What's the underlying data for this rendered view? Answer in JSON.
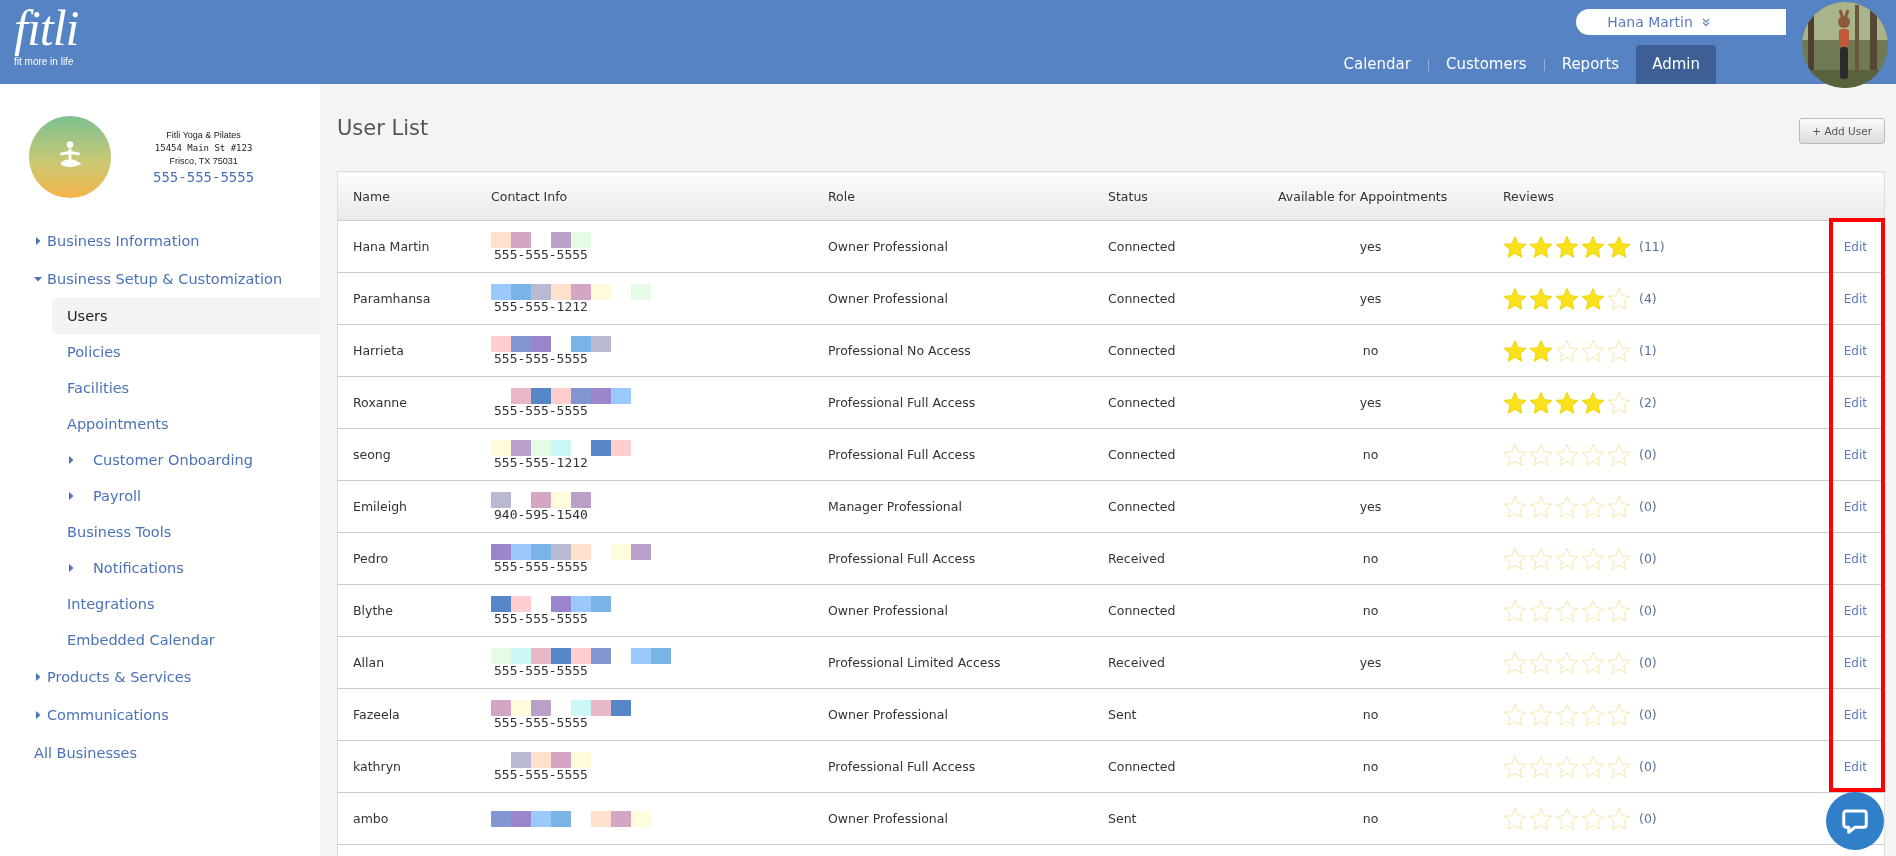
{
  "brand": {
    "name": "fitli",
    "tagline": "fit more in life"
  },
  "user_menu": {
    "name": "Hana Martin"
  },
  "nav_tabs": [
    {
      "label": "Calendar",
      "selected": false
    },
    {
      "label": "Customers",
      "selected": false
    },
    {
      "label": "Reports",
      "selected": false
    },
    {
      "label": "Admin",
      "selected": true
    }
  ],
  "business": {
    "name": "Fitli Yoga & Pilates",
    "address_line": "15454 Main St #123",
    "city_line": "Frisco, TX 75031",
    "phone": "555-555-5555"
  },
  "sidebar": {
    "items": [
      {
        "label": "Business Information",
        "expanded": false,
        "selected": false
      },
      {
        "label": "Business Setup & Customization",
        "expanded": true,
        "selected": false,
        "children": [
          {
            "label": "Users",
            "selected": true
          },
          {
            "label": "Policies",
            "selected": false
          },
          {
            "label": "Facilities",
            "selected": false
          },
          {
            "label": "Appointments",
            "selected": false
          },
          {
            "label": "Customer Onboarding",
            "expanded": false,
            "selected": false
          },
          {
            "label": "Payroll",
            "expanded": false,
            "selected": false
          },
          {
            "label": "Business Tools",
            "selected": false
          },
          {
            "label": "Notifications",
            "expanded": false,
            "selected": false
          },
          {
            "label": "Integrations",
            "selected": false
          },
          {
            "label": "Embedded Calendar",
            "selected": false
          }
        ]
      },
      {
        "label": "Products & Services",
        "expanded": false,
        "selected": false
      },
      {
        "label": "Communications",
        "expanded": false,
        "selected": false
      },
      {
        "label": "All Businesses",
        "selected": false
      }
    ]
  },
  "page_title": "User List",
  "add_button": "+ Add User",
  "table": {
    "columns": [
      "Name",
      "Contact Info",
      "Role",
      "Status",
      "Available for Appointments",
      "Reviews"
    ],
    "edit_highlighted": true,
    "rows": [
      {
        "name": "Hana Martin",
        "phone": "555-555-5555",
        "role": "Owner Professional",
        "status": "Connected",
        "available": "yes",
        "stars": 5,
        "review_count": "(11)",
        "action": "Edit"
      },
      {
        "name": "Paramhansa",
        "phone": "555-555-1212",
        "role": "Owner Professional",
        "status": "Connected",
        "available": "yes",
        "stars": 4,
        "review_count": "(4)",
        "action": "Edit"
      },
      {
        "name": "Harrieta",
        "phone": "555-555-5555",
        "role": "Professional No Access",
        "status": "Connected",
        "available": "no",
        "stars": 2,
        "review_count": "(1)",
        "action": "Edit"
      },
      {
        "name": "Roxanne",
        "phone": "555-555-5555",
        "role": "Professional Full Access",
        "status": "Connected",
        "available": "yes",
        "stars": 4,
        "review_count": "(2)",
        "action": "Edit"
      },
      {
        "name": "seong",
        "phone": "555-555-1212",
        "role": "Professional Full Access",
        "status": "Connected",
        "available": "no",
        "stars": 0,
        "review_count": "(0)",
        "action": "Edit"
      },
      {
        "name": "Emileigh",
        "phone": "940-595-1540",
        "role": "Manager Professional",
        "status": "Connected",
        "available": "yes",
        "stars": 0,
        "review_count": "(0)",
        "action": "Edit"
      },
      {
        "name": "Pedro",
        "phone": "555-555-5555",
        "role": "Professional Full Access",
        "status": "Received",
        "available": "no",
        "stars": 0,
        "review_count": "(0)",
        "action": "Edit"
      },
      {
        "name": "Blythe",
        "phone": "555-555-5555",
        "role": "Owner Professional",
        "status": "Connected",
        "available": "no",
        "stars": 0,
        "review_count": "(0)",
        "action": "Edit"
      },
      {
        "name": "Allan",
        "phone": "555-555-5555",
        "role": "Professional Limited Access",
        "status": "Received",
        "available": "yes",
        "stars": 0,
        "review_count": "(0)",
        "action": "Edit"
      },
      {
        "name": "Fazeela",
        "phone": "555-555-5555",
        "role": "Owner Professional",
        "status": "Sent",
        "available": "no",
        "stars": 0,
        "review_count": "(0)",
        "action": "Edit"
      },
      {
        "name": "kathryn",
        "phone": "555-555-5555",
        "role": "Professional Full Access",
        "status": "Connected",
        "available": "no",
        "stars": 0,
        "review_count": "(0)",
        "action": "Edit"
      },
      {
        "name": "ambo",
        "role": "Owner Professional",
        "status": "Sent",
        "available": "no",
        "stars": 0,
        "review_count": "(0)"
      }
    ]
  }
}
